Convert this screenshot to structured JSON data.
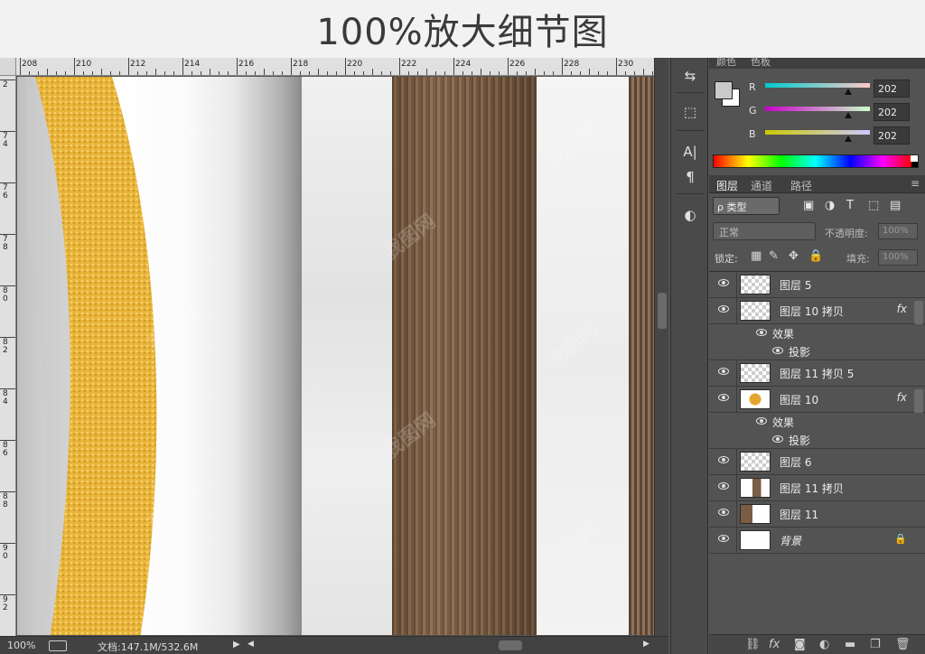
{
  "banner": {
    "title": "100%放大细节图"
  },
  "ruler": {
    "h_ticks": [
      "208",
      "210",
      "212",
      "214",
      "216",
      "218",
      "220",
      "222",
      "224",
      "226",
      "228",
      "230"
    ],
    "v_ticks": [
      "2",
      "7 4",
      "7 6",
      "7 8",
      "8 0",
      "8 2",
      "8 4",
      "8 6",
      "8 8",
      "9 0",
      "9 2"
    ]
  },
  "status": {
    "zoom": "100%",
    "doc": "文档:147.1M/532.6M",
    "arrow": "▶"
  },
  "color_panel": {
    "tabs": [
      "颜色",
      "色板"
    ],
    "sliders": [
      {
        "label": "R",
        "value": "202"
      },
      {
        "label": "G",
        "value": "202"
      },
      {
        "label": "B",
        "value": "202"
      }
    ]
  },
  "layers_panel": {
    "tabs": [
      "图层",
      "通道",
      "路径"
    ],
    "filter": "ρ 类型",
    "blend_mode": "正常",
    "opacity_label": "不透明度:",
    "opacity_value": "100%",
    "lock_label": "锁定:",
    "fill_label": "填充:",
    "fill_value": "100%",
    "layers": [
      {
        "name": "图层 5",
        "fx": "",
        "lock": ""
      },
      {
        "name": "图层 10 拷贝",
        "fx": "fx",
        "lock": "",
        "effects_label": "效果",
        "effect": "投影"
      },
      {
        "name": "图层 11 拷贝 5",
        "fx": "",
        "lock": ""
      },
      {
        "name": "图层 10",
        "fx": "fx",
        "lock": "",
        "effects_label": "效果",
        "effect": "投影"
      },
      {
        "name": "图层 6",
        "fx": "",
        "lock": ""
      },
      {
        "name": "图层 11 拷贝",
        "fx": "",
        "lock": ""
      },
      {
        "name": "图层 11",
        "fx": "",
        "lock": ""
      },
      {
        "name": "背景",
        "fx": "",
        "lock": "🔒"
      }
    ]
  },
  "colors": {
    "panel_bg": "#535353",
    "gold": "#e9b53c",
    "wood": "#7a5d45"
  }
}
